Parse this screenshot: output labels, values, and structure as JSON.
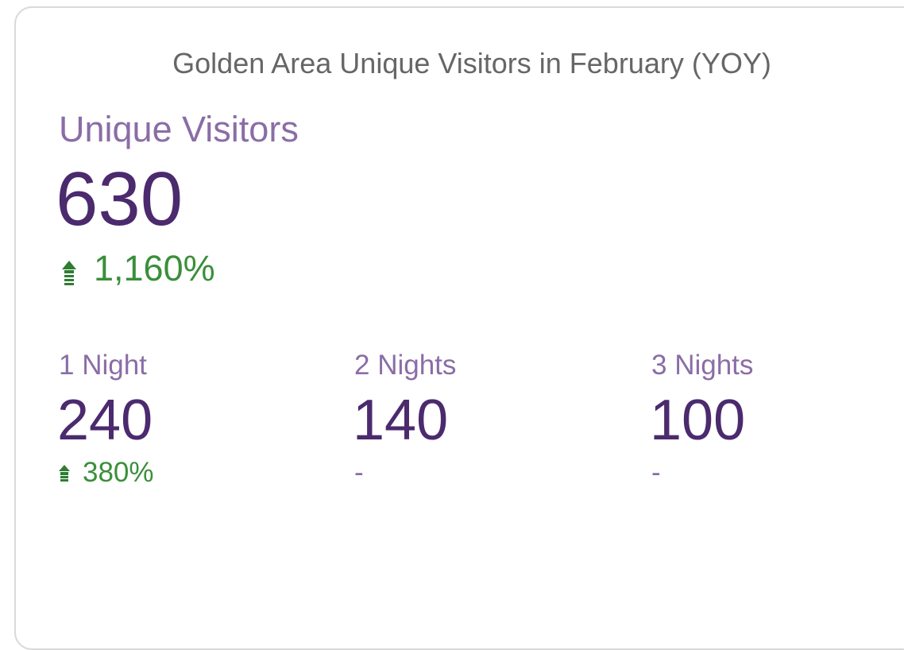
{
  "card": {
    "title": "Golden Area Unique Visitors in February (YOY)"
  },
  "main": {
    "label": "Unique Visitors",
    "value": "630",
    "change": "1,160%",
    "change_direction": "up",
    "change_icon": "arrow-up-icon"
  },
  "metrics": [
    {
      "label": "1 Night",
      "value": "240",
      "change": "380%",
      "change_direction": "up"
    },
    {
      "label": "2 Nights",
      "value": "140",
      "change": "-"
    },
    {
      "label": "3 Nights",
      "value": "100",
      "change": "-"
    }
  ],
  "colors": {
    "label": "#8a6da6",
    "value": "#4b2a6e",
    "positive": "#3a8f3a",
    "title": "#666666",
    "border": "#d9d9d9"
  }
}
